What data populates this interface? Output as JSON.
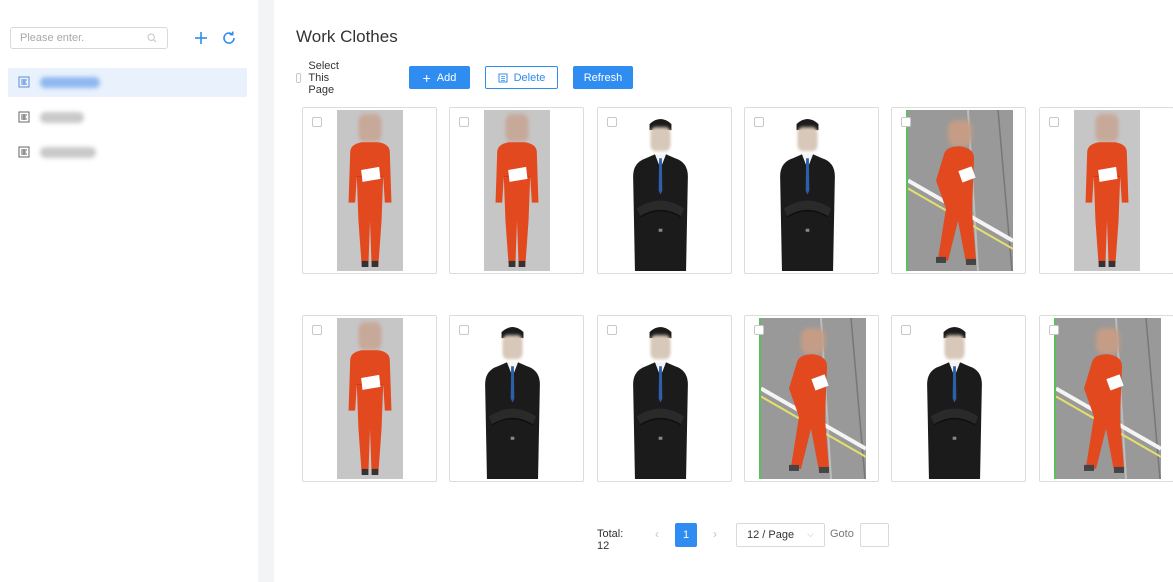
{
  "sidebar": {
    "search": {
      "placeholder": "Please enter.",
      "value": ""
    },
    "tools": [
      {
        "name": "add-icon",
        "color": "#2f8cf0"
      },
      {
        "name": "refresh-icon",
        "color": "#2f8cf0"
      }
    ],
    "tree": [
      {
        "icon": "library-icon",
        "label_blurred": true,
        "selected": true
      },
      {
        "icon": "library-icon",
        "label_blurred": true,
        "selected": false
      },
      {
        "icon": "library-icon",
        "label_blurred": true,
        "selected": false
      }
    ]
  },
  "main": {
    "title": "Work Clothes",
    "toolbar": {
      "select_page_label": "Select This Page",
      "add_label": "Add",
      "delete_label": "Delete",
      "refresh_label": "Refresh"
    },
    "cards": [
      {
        "image": "person-orange-workwear"
      },
      {
        "image": "person-orange-workwear"
      },
      {
        "image": "person-black-suit"
      },
      {
        "image": "person-black-suit"
      },
      {
        "image": "person-orange-workwear-street"
      },
      {
        "image": "person-orange-workwear"
      },
      {
        "image": "person-orange-workwear"
      },
      {
        "image": "person-black-suit"
      },
      {
        "image": "person-black-suit"
      },
      {
        "image": "person-orange-workwear-street"
      },
      {
        "image": "person-black-suit"
      },
      {
        "image": "person-orange-workwear-street"
      }
    ]
  },
  "pagination": {
    "total_label": "Total: 12",
    "current_page": "1",
    "page_size": "12 / Page",
    "goto_label": "Goto",
    "goto_value": ""
  },
  "colors": {
    "accent": "#2f8cf0",
    "selected_bg": "#e8f1fc",
    "workwear": "#e2491e",
    "suit": "#1b1b1b"
  }
}
